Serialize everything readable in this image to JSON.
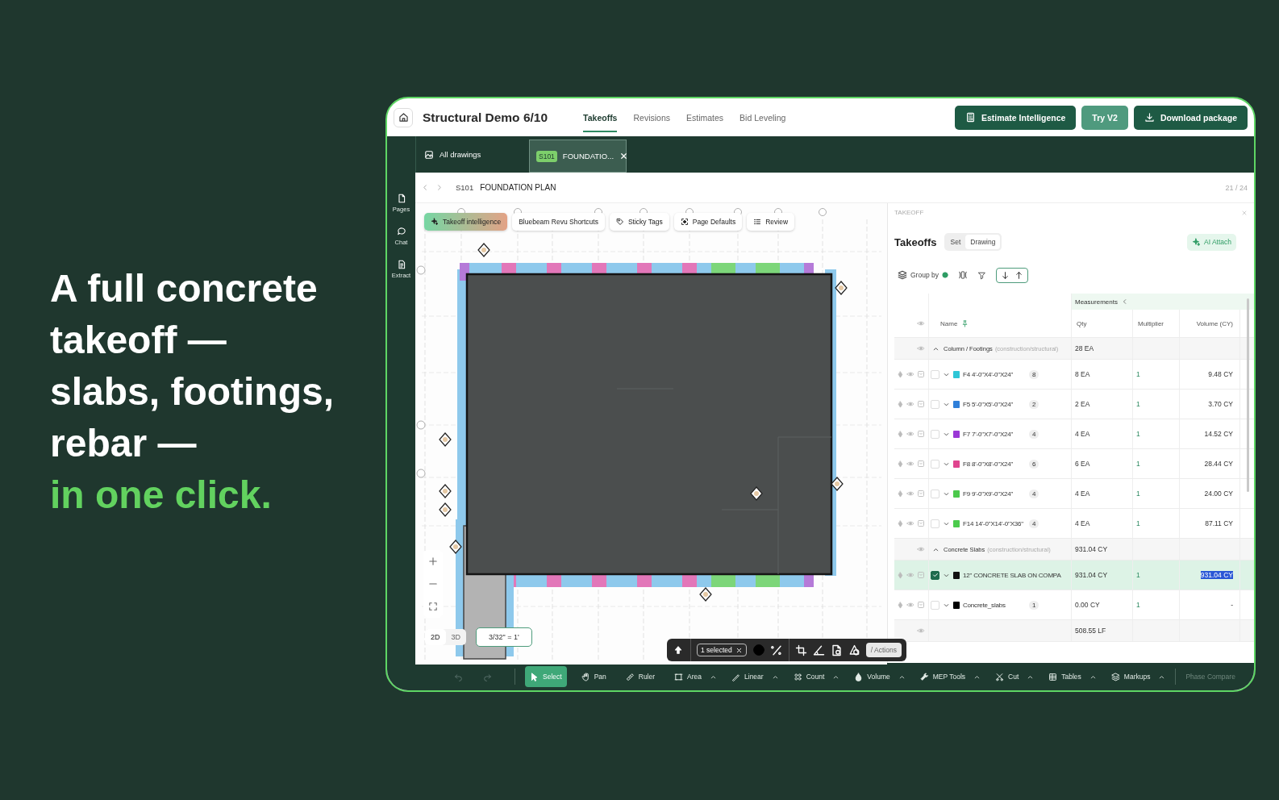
{
  "headline": {
    "lines": [
      "A full concrete",
      "takeoff —",
      "slabs, footings,",
      "rebar —"
    ],
    "highlight": "in one click."
  },
  "app": {
    "title": "Structural Demo 6/10",
    "nav_tabs": [
      {
        "label": "Takeoffs",
        "selected": true
      },
      {
        "label": "Revisions",
        "selected": false
      },
      {
        "label": "Estimates",
        "selected": false
      },
      {
        "label": "Bid Leveling",
        "selected": false
      }
    ],
    "header_buttons": [
      {
        "label": "Estimate Intelligence",
        "kind": "estimate"
      },
      {
        "label": "Try V2",
        "kind": "try"
      },
      {
        "label": "Download package",
        "kind": "download"
      }
    ],
    "drawing_tabs": [
      {
        "label": "All drawings",
        "selected": false
      },
      {
        "sheet": "S101",
        "label": "FOUNDATIO...",
        "selected": true
      }
    ],
    "side_rail": [
      {
        "label": "Pages",
        "kind": "pages"
      },
      {
        "label": "Chat",
        "kind": "chat"
      },
      {
        "label": "Extract",
        "kind": "extract"
      }
    ],
    "breadcrumb": {
      "sheet": "S101",
      "title": "FOUNDATION PLAN",
      "page": "21 / 24"
    },
    "canvas_toolbar": [
      {
        "label": "Takeoff intelligence",
        "kind": "ai"
      },
      {
        "label": "Bluebeam Revu Shortcuts",
        "kind": "plain"
      },
      {
        "label": "Sticky Tags",
        "kind": "tag"
      },
      {
        "label": "Page Defaults",
        "kind": "focus"
      },
      {
        "label": "Review",
        "kind": "list"
      }
    ],
    "view_modes": [
      {
        "label": "2D",
        "selected": true
      },
      {
        "label": "3D",
        "selected": false
      }
    ],
    "scale": "3/32\" = 1'",
    "selection_bar": {
      "count": "1 selected",
      "actions": "/ Actions"
    },
    "takeoff_panel": {
      "section": "TAKEOFF",
      "title": "Takeoffs",
      "scope_tabs": [
        {
          "label": "Set",
          "selected": false
        },
        {
          "label": "Drawing",
          "selected": true
        }
      ],
      "ai_button": "AI Attach",
      "group_by": "Group by",
      "column_group": "Measurements",
      "columns": [
        "Name",
        "Qty",
        "Multiplier",
        "Volume (CY)"
      ],
      "rows": [
        {
          "kind": "group",
          "name": "Column / Footings",
          "tag": "(construction/structural)",
          "qty": "28 EA",
          "expanded": true
        },
        {
          "kind": "item",
          "name": "F4 4'-0\"X4'-0\"X24\"",
          "count": "8",
          "color": "#2ec6d6",
          "qty": "8 EA",
          "multiplier": "1",
          "volume": "9.48 CY",
          "checked": false,
          "selected": false
        },
        {
          "kind": "item",
          "name": "F5 5'-0\"X5'-0\"X24\"",
          "count": "2",
          "color": "#2f7fd9",
          "qty": "2 EA",
          "multiplier": "1",
          "volume": "3.70 CY",
          "checked": false,
          "selected": false
        },
        {
          "kind": "item",
          "name": "F7 7'-0\"X7'-0\"X24\"",
          "count": "4",
          "color": "#9b38d6",
          "qty": "4 EA",
          "multiplier": "1",
          "volume": "14.52 CY",
          "checked": false,
          "selected": false
        },
        {
          "kind": "item",
          "name": "F8 8'-0\"X8'-0\"X24\"",
          "count": "6",
          "color": "#e0458f",
          "qty": "6 EA",
          "multiplier": "1",
          "volume": "28.44 CY",
          "checked": false,
          "selected": false
        },
        {
          "kind": "item",
          "name": "F9 9'-0\"X9'-0\"X24\"",
          "count": "4",
          "color": "#4cc94c",
          "qty": "4 EA",
          "multiplier": "1",
          "volume": "24.00 CY",
          "checked": false,
          "selected": false
        },
        {
          "kind": "item",
          "name": "F14 14'-0\"X14'-0\"X36\"",
          "count": "4",
          "color": "#4ccb4d",
          "qty": "4 EA",
          "multiplier": "1",
          "volume": "87.11 CY",
          "checked": false,
          "selected": false
        },
        {
          "kind": "group",
          "name": "Concrete Slabs",
          "tag": "(construction/structural)",
          "qty": "931.04 CY",
          "expanded": true
        },
        {
          "kind": "item",
          "name": "12\" CONCRETE SLAB ON COMPA",
          "color": "#111111",
          "qty": "931.04 CY",
          "multiplier": "1",
          "volume": "931.04 CY",
          "checked": true,
          "selected": true
        },
        {
          "kind": "item",
          "name": "Concrete_slabs",
          "count": "1",
          "color": "#000000",
          "qty": "0.00 CY",
          "multiplier": "1",
          "volume": "-",
          "checked": false,
          "selected": false
        },
        {
          "kind": "group",
          "qty": "508.55 LF"
        }
      ]
    },
    "tools": [
      {
        "label": "Select",
        "kind": "select",
        "selected": true,
        "menu": false
      },
      {
        "label": "Pan",
        "kind": "pan",
        "selected": false,
        "menu": false
      },
      {
        "label": "Ruler",
        "kind": "ruler",
        "selected": false,
        "menu": false
      },
      {
        "label": "Area",
        "kind": "area",
        "selected": false,
        "menu": true
      },
      {
        "label": "Linear",
        "kind": "linear",
        "selected": false,
        "menu": true
      },
      {
        "label": "Count",
        "kind": "count",
        "selected": false,
        "menu": true
      },
      {
        "label": "Volume",
        "kind": "volume",
        "selected": false,
        "menu": true
      },
      {
        "label": "MEP Tools",
        "kind": "mep",
        "selected": false,
        "menu": true
      },
      {
        "label": "Cut",
        "kind": "cut",
        "selected": false,
        "menu": true
      },
      {
        "label": "Tables",
        "kind": "tables",
        "selected": false,
        "menu": true
      },
      {
        "label": "Markups",
        "kind": "markups",
        "selected": false,
        "menu": true
      }
    ],
    "phase_compare": {
      "label": "Phase Compare",
      "disabled": true
    }
  }
}
